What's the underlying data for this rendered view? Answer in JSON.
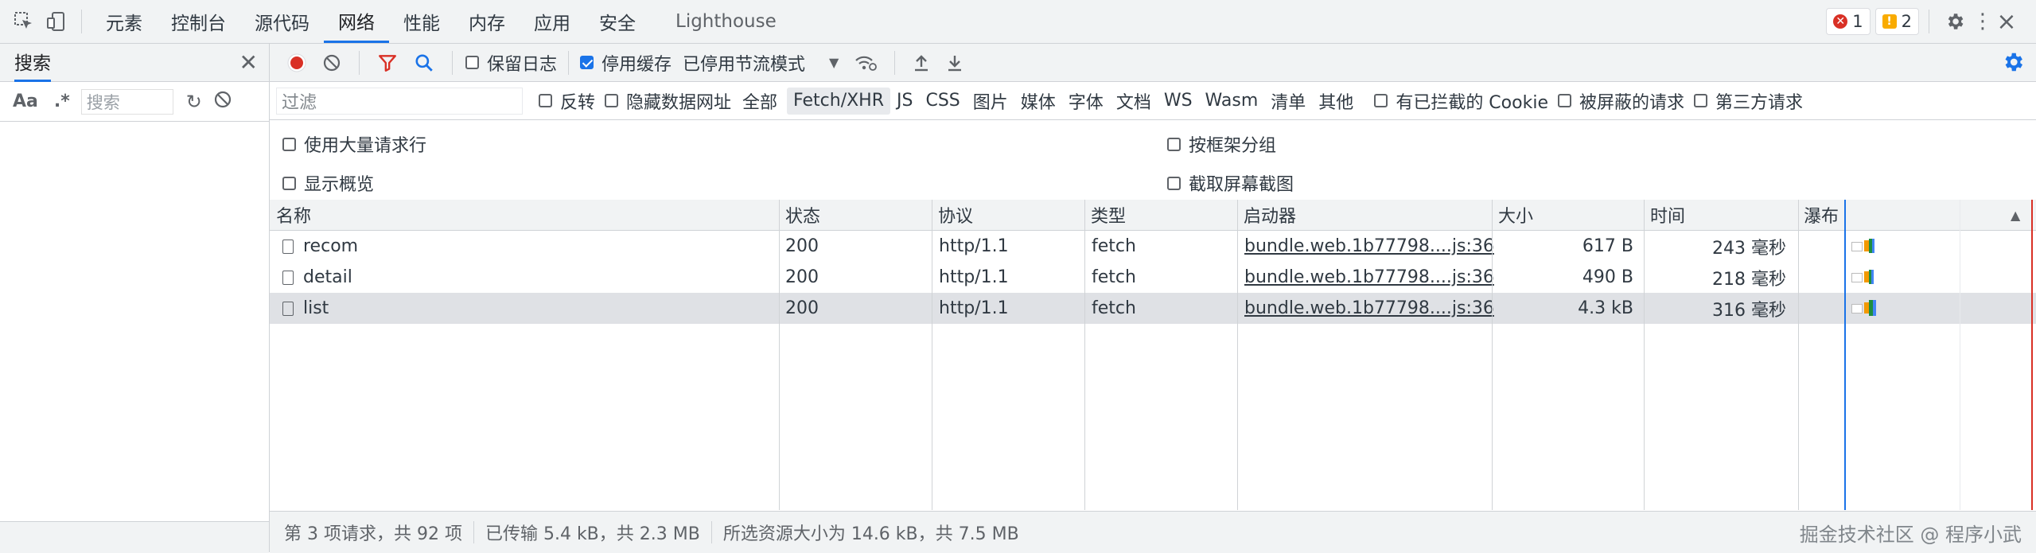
{
  "topbar": {
    "tabs": [
      {
        "label": "元素"
      },
      {
        "label": "控制台"
      },
      {
        "label": "源代码"
      },
      {
        "label": "网络"
      },
      {
        "label": "性能"
      },
      {
        "label": "内存"
      },
      {
        "label": "应用"
      },
      {
        "label": "安全"
      },
      {
        "label": "Lighthouse"
      }
    ],
    "active_tab": "网络",
    "error_count": "1",
    "warning_count": "2"
  },
  "search_panel": {
    "title": "搜索",
    "case_toggle": "Aa",
    "regex_toggle": ".*",
    "input_placeholder": "搜索"
  },
  "toolbar": {
    "preserve_log_label": "保留日志",
    "preserve_log_checked": false,
    "disable_cache_label": "停用缓存",
    "disable_cache_checked": true,
    "throttle_value": "已停用节流模式"
  },
  "filter_bar": {
    "filter_placeholder": "过滤",
    "invert_label": "反转",
    "hide_data_urls_label": "隐藏数据网址",
    "types": [
      "全部",
      "Fetch/XHR",
      "JS",
      "CSS",
      "图片",
      "媒体",
      "字体",
      "文档",
      "WS",
      "Wasm",
      "清单",
      "其他"
    ],
    "active_type": "Fetch/XHR",
    "blocked_cookies_label": "有已拦截的 Cookie",
    "blocked_requests_label": "被屏蔽的请求",
    "third_party_label": "第三方请求"
  },
  "options": {
    "big_rows_label": "使用大量请求行",
    "group_by_frame_label": "按框架分组",
    "overview_label": "显示概览",
    "screenshots_label": "截取屏幕截图"
  },
  "table": {
    "headers": {
      "name": "名称",
      "status": "状态",
      "protocol": "协议",
      "type": "类型",
      "initiator": "启动器",
      "size": "大小",
      "time": "时间",
      "waterfall": "瀑布"
    },
    "rows": [
      {
        "name": "recom",
        "status": "200",
        "protocol": "http/1.1",
        "type": "fetch",
        "initiator": "bundle.web.1b77798....js:36",
        "size": "617 B",
        "time": "243 毫秒"
      },
      {
        "name": "detail",
        "status": "200",
        "protocol": "http/1.1",
        "type": "fetch",
        "initiator": "bundle.web.1b77798....js:36",
        "size": "490 B",
        "time": "218 毫秒"
      },
      {
        "name": "list",
        "status": "200",
        "protocol": "http/1.1",
        "type": "fetch",
        "initiator": "bundle.web.1b77798....js:36",
        "size": "4.3 kB",
        "time": "316 毫秒"
      }
    ],
    "selected_row": 2
  },
  "statusbar": {
    "requests": "第 3 项请求，共 92 项",
    "transferred": "已传输 5.4 kB，共 2.3 MB",
    "resources": "所选资源大小为 14.6 kB，共 7.5 MB",
    "watermark": "掘金技术社区 @ 程序小武"
  },
  "colors": {
    "accent": "#1a73e8",
    "record_red": "#d93025",
    "filter_red": "#d93025",
    "selected_row": "#dfe1e5",
    "chrome_bg": "#f1f3f4"
  }
}
